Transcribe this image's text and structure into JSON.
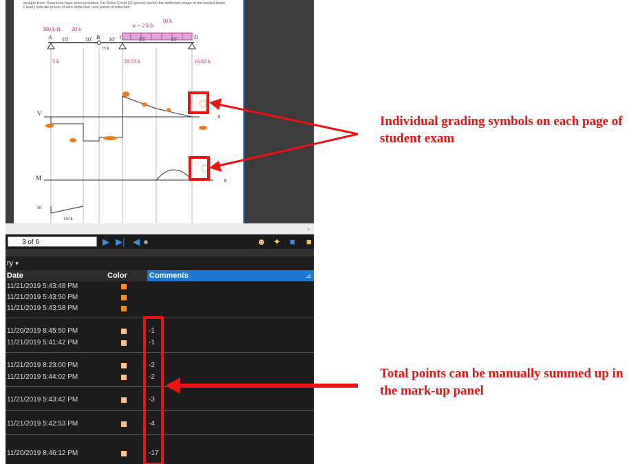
{
  "document": {
    "instructions": "straight lines. Reactions have been provided. For Extra Credit (10 points) sketch the deflected shape of the loaded beam. Clearly indicate points of zero deflection, and points of inflection.",
    "sketch": {
      "moment_load": "300 k-ft",
      "point_load_1": "20 k",
      "point_load_2": "10 k",
      "distributed_load": "w = 2 k/ft",
      "spans": [
        "10'",
        "10'",
        "10'",
        "15'",
        "15'"
      ],
      "nodes": [
        "A",
        "B",
        "C",
        "D"
      ],
      "hinge_label": "15 k",
      "reactions": [
        "5 k",
        "58.53 k",
        "16.62 k"
      ],
      "shear_axis": "V",
      "moment_axis": "M",
      "axis_x": "x",
      "moment_value": "50",
      "moment_label": "150 k"
    }
  },
  "toolbar": {
    "page_indicator": "3 of 6",
    "icons": [
      "next-page-icon",
      "last-page-icon",
      "previous-view-icon",
      "next-view-icon",
      "user-icon",
      "lightbulb-icon",
      "properties-icon",
      "folder-icon"
    ]
  },
  "markups_panel": {
    "title": "ry",
    "columns": [
      "Date",
      "Color",
      "Comments"
    ],
    "rows": [
      {
        "date": "11/21/2019 5:43:48 PM",
        "color": "#ff8c1a",
        "comment": ""
      },
      {
        "date": "11/21/2019 5:43:50 PM",
        "color": "#ff8c1a",
        "comment": ""
      },
      {
        "date": "11/21/2019 5:43:58 PM",
        "color": "#ff8c1a",
        "comment": ""
      },
      {
        "date": "11/20/2019 8:45:50 PM",
        "color": "#ffc090",
        "comment": "-1"
      },
      {
        "date": "11/21/2019 5:41:42 PM",
        "color": "#ffc090",
        "comment": "-1"
      },
      {
        "date": "11/21/2019 8:23:00 PM",
        "color": "#ffc090",
        "comment": "-2"
      },
      {
        "date": "11/21/2019 5:44:02 PM",
        "color": "#ffc090",
        "comment": "-2"
      },
      {
        "date": "11/21/2019 5:43:42 PM",
        "color": "#ffc090",
        "comment": "-3"
      },
      {
        "date": "11/21/2019 5:42:53 PM",
        "color": "#ffc090",
        "comment": "-4"
      },
      {
        "date": "11/20/2019 8:46:12 PM",
        "color": "#ffc090",
        "comment": "-17"
      }
    ]
  },
  "annotations": {
    "top_text": "Individual grading symbols on each page of student exam",
    "bottom_text": "Total points can be manually summed up in the mark-up panel",
    "color": "#ee1111"
  }
}
